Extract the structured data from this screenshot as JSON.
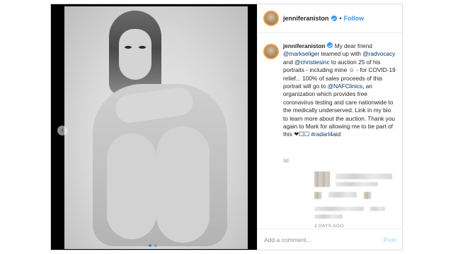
{
  "post": {
    "photo_alt": "Black and white portrait",
    "carousel": {
      "total": 2,
      "active": 1
    },
    "prev_glyph": "‹"
  },
  "header": {
    "username": "jenniferaniston",
    "separator": "•",
    "follow_label": "Follow"
  },
  "caption": {
    "username": "jenniferaniston",
    "segments": [
      {
        "type": "text",
        "text": " My dear friend "
      },
      {
        "type": "tag",
        "text": "@markseliger"
      },
      {
        "type": "text",
        "text": " teamed up with "
      },
      {
        "type": "tag",
        "text": "@radvocacy"
      },
      {
        "type": "text",
        "text": " and "
      },
      {
        "type": "tag",
        "text": "@christiesinc"
      },
      {
        "type": "text",
        "text": " to auction 25 of his portraits - including mine ☺ - for COVID-19 relief... 100% of sales proceeds of this portrait will go to "
      },
      {
        "type": "tag",
        "text": "@NAFClinics"
      },
      {
        "type": "text",
        "text": ", an organization which provides free coronavirus testing and care nationwide to the medically underserved. Link in my bio to learn more about the auction. Thank you again to Mark for allowing me to be part of this ❤︎☐☐ "
      },
      {
        "type": "tag",
        "text": "#radart4aid"
      }
    ],
    "time": "3d"
  },
  "footer": {
    "days_ago": "3 DAYS AGO",
    "comment_placeholder": "Add a comment...",
    "post_label": "Post"
  },
  "colors": {
    "accent": "#3897f0",
    "tag": "#00376b",
    "border": "#dbdbdb",
    "muted": "#8e8e8e"
  }
}
